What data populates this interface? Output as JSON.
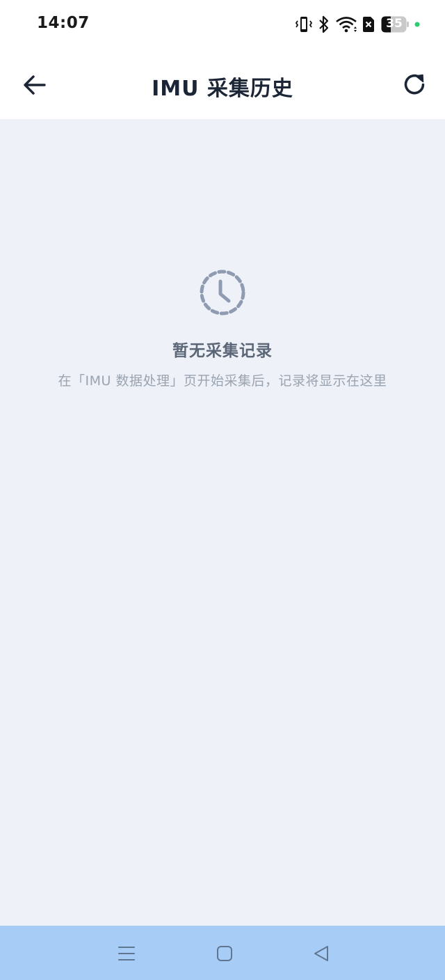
{
  "status_bar": {
    "time": "14:07",
    "battery_level": "35",
    "icons": [
      "vibrate-icon",
      "bluetooth-icon",
      "wifi-icon",
      "sim-missing-icon",
      "battery-icon",
      "dot-indicator-icon"
    ]
  },
  "header": {
    "title": "IMU 采集历史",
    "back_icon": "arrow-left-icon",
    "refresh_icon": "refresh-icon"
  },
  "empty_state": {
    "icon": "history-icon",
    "title": "暂无采集记录",
    "description": "在「IMU 数据处理」页开始采集后，记录将显示在这里"
  },
  "nav_bar": {
    "icons": [
      "menu-icon",
      "home-icon",
      "back-icon"
    ]
  },
  "colors": {
    "background": "#eef2f8",
    "header_background": "#ffffff",
    "title_text": "#1c2535",
    "muted_icon": "#8f9bb0",
    "empty_title": "#5b6677",
    "empty_desc": "#9aa3b0",
    "nav_bar": "#a7cdf7",
    "status_dot": "#2ecc71"
  }
}
